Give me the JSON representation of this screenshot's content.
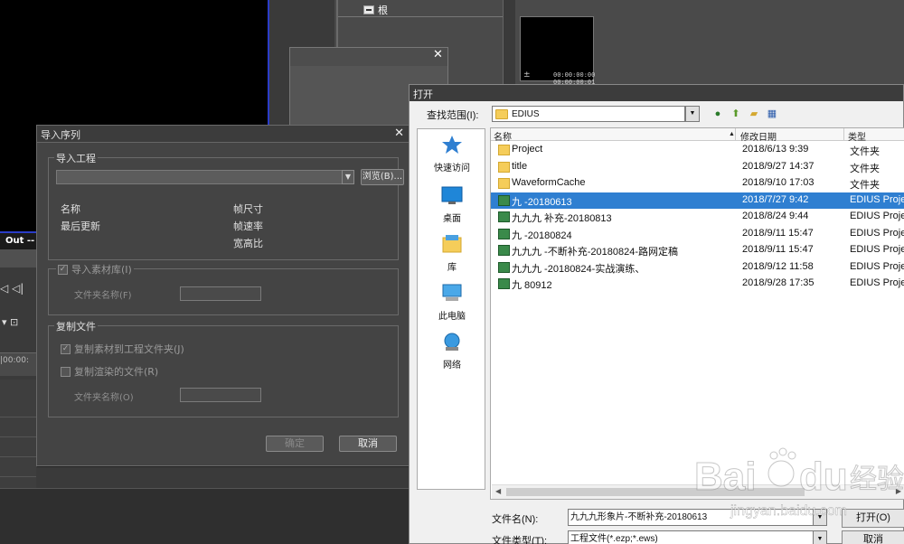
{
  "background": {
    "root_label": "根",
    "timecode_top": "00:00:00:00",
    "timecode_bottom": "00:00:00:01",
    "out_label": "Out --",
    "timeline_tc": "|00:00:"
  },
  "import_dialog": {
    "title": "导入序列",
    "project_group": "导入工程",
    "combo_value": "",
    "browse_label": "浏览(B)...",
    "info_left": [
      "名称",
      "最后更新"
    ],
    "info_right": [
      "帧尺寸",
      "帧速率",
      "宽高比"
    ],
    "bin_checkbox": "导入素材库(I)",
    "bin_folder_label": "文件夹名称(F)",
    "copy_group": "复制文件",
    "copy_to_project": "复制素材到工程文件夹(J)",
    "copy_rendered": "复制渲染的文件(R)",
    "copy_folder_label": "文件夹名称(O)",
    "ok_label": "确定",
    "cancel_label": "取消"
  },
  "open_dialog": {
    "title": "打开",
    "lookin_label": "查找范围(I):",
    "lookin_value": "EDIUS",
    "places": [
      "快速访问",
      "桌面",
      "库",
      "此电脑",
      "网络"
    ],
    "columns": [
      "名称",
      "修改日期",
      "类型"
    ],
    "rows": [
      {
        "name": "Project",
        "date": "2018/6/13 9:39",
        "type": "文件夹",
        "kind": "folder"
      },
      {
        "name": "title",
        "date": "2018/9/27 14:37",
        "type": "文件夹",
        "kind": "folder"
      },
      {
        "name": "WaveformCache",
        "date": "2018/9/10 17:03",
        "type": "文件夹",
        "kind": "folder"
      },
      {
        "name": "九                    -20180613",
        "date": "2018/7/27 9:42",
        "type": "EDIUS Proje",
        "kind": "edius",
        "selected": true
      },
      {
        "name": "九九九              补充-20180813",
        "date": "2018/8/24 9:44",
        "type": "EDIUS Proje",
        "kind": "edius"
      },
      {
        "name": "九                  -20180824",
        "date": "2018/9/11 15:47",
        "type": "EDIUS Proje",
        "kind": "edius"
      },
      {
        "name": "九九九        -不断补充-20180824-路网定稿",
        "date": "2018/9/11 15:47",
        "type": "EDIUS Proje",
        "kind": "edius"
      },
      {
        "name": "九九九              -20180824-实战演练、",
        "date": "2018/9/12 11:58",
        "type": "EDIUS Proje",
        "kind": "edius"
      },
      {
        "name": "九                   80912",
        "date": "2018/9/28 17:35",
        "type": "EDIUS Proje",
        "kind": "edius"
      }
    ],
    "filename_label": "文件名(N):",
    "filename_value": "九九九形象片-不断补充-20180613",
    "filetype_label": "文件类型(T):",
    "filetype_value": "工程文件(*.ezp;*.ews)",
    "open_label": "打开(O)",
    "cancel_label": "取消"
  },
  "watermark": {
    "brand": "Bai",
    "brand2": "du",
    "cn": "经验",
    "url": "jingyan.baidu.com"
  }
}
